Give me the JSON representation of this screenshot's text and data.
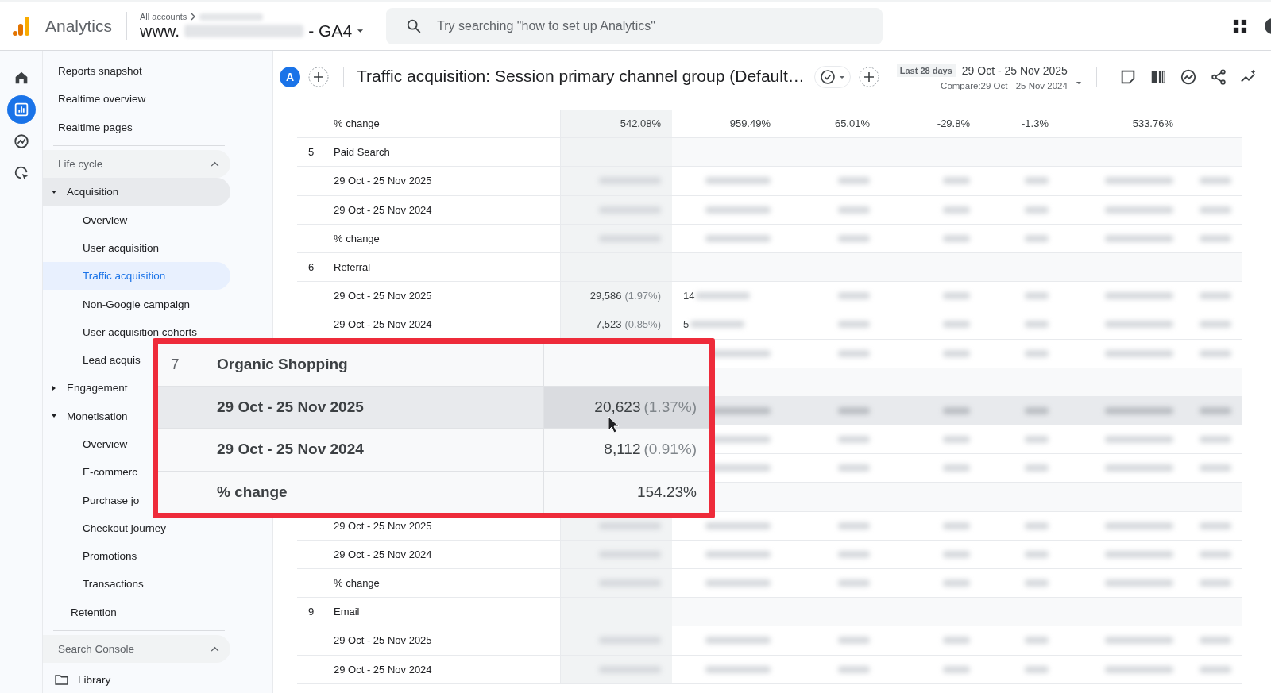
{
  "topbar": {
    "product": "Analytics",
    "breadcrumb": "All accounts",
    "property_prefix": "www.",
    "property_suffix": "- GA4",
    "search": {
      "placeholder": "Try searching \"how to set up Analytics\""
    }
  },
  "rail": [
    {
      "selected": false
    },
    {
      "selected": true
    },
    {
      "selected": false
    },
    {
      "selected": false
    }
  ],
  "nav": [
    {
      "kind": "link",
      "label": "Reports snapshot"
    },
    {
      "kind": "link",
      "label": "Realtime overview"
    },
    {
      "kind": "link",
      "label": "Realtime pages"
    },
    {
      "kind": "section",
      "label": "Life cycle",
      "expanded": true,
      "children": [
        {
          "kind": "topic",
          "label": "Acquisition",
          "expanded": true,
          "active": true,
          "children": [
            {
              "label": "Overview",
              "selected": false
            },
            {
              "label": "User acquisition",
              "selected": false
            },
            {
              "label": "Traffic acquisition",
              "selected": true
            },
            {
              "label": "Non-Google campaign",
              "selected": false
            },
            {
              "label": "User acquisition cohorts",
              "selected": false
            },
            {
              "label": "Lead acquis",
              "selected": false
            }
          ]
        },
        {
          "kind": "topic",
          "label": "Engagement",
          "expanded": false,
          "active": false
        },
        {
          "kind": "topic",
          "label": "Monetisation",
          "expanded": true,
          "active": false,
          "children": [
            {
              "label": "Overview",
              "selected": false
            },
            {
              "label": "E-commerc",
              "selected": false
            },
            {
              "label": "Purchase jo",
              "selected": false
            },
            {
              "label": "Checkout journey",
              "selected": false
            },
            {
              "label": "Promotions",
              "selected": false
            },
            {
              "label": "Transactions",
              "selected": false
            }
          ]
        },
        {
          "kind": "link",
          "label": "Retention"
        }
      ]
    },
    {
      "kind": "section",
      "label": "Search Console",
      "expanded": true
    },
    {
      "kind": "library",
      "label": "Library"
    }
  ],
  "report": {
    "avatar": "A",
    "title": "Traffic acquisition: Session primary channel group (Default…",
    "range_chip": "Last 28 days",
    "range": "29 Oct - 25 Nov 2025",
    "compare": "Compare:29 Oct - 25 Nov 2024"
  },
  "table": {
    "rows": [
      {
        "kind": "metric",
        "label": "% change",
        "values": [
          {
            "value": "542.08%"
          },
          {
            "value": "959.49%"
          },
          {
            "value": "65.01%"
          },
          {
            "value": "-29.8%"
          },
          {
            "value": "-1.3%"
          },
          {
            "value": "533.76%"
          }
        ]
      },
      {
        "kind": "group",
        "number": "5",
        "label": "Paid Search"
      },
      {
        "kind": "metric",
        "label": "29 Oct - 25 Nov 2025",
        "redacted": true
      },
      {
        "kind": "metric",
        "label": "29 Oct - 25 Nov 2024",
        "redacted": true
      },
      {
        "kind": "metric",
        "label": "% change",
        "redacted": true
      },
      {
        "kind": "group",
        "number": "6",
        "label": "Referral"
      },
      {
        "kind": "metric",
        "label": "29 Oct - 25 Nov 2025",
        "redacted": true,
        "values": [
          {
            "value": "29,586",
            "share": "(1.97%)"
          },
          {
            "value": "14",
            "kind": "partial"
          }
        ]
      },
      {
        "kind": "metric",
        "label": "29 Oct - 25 Nov 2024",
        "redacted": true,
        "values": [
          {
            "value": "7,523",
            "share": "(0.85%)"
          },
          {
            "value": "5",
            "kind": "partial"
          }
        ]
      },
      {
        "kind": "metric",
        "redacted": true
      },
      {
        "kind": "group"
      },
      {
        "kind": "metric",
        "redacted": true,
        "highlighted": true
      },
      {
        "kind": "metric",
        "redacted": true
      },
      {
        "kind": "metric",
        "redacted": true
      },
      {
        "kind": "group"
      },
      {
        "kind": "metric",
        "label": "29 Oct - 25 Nov 2025",
        "redacted": true
      },
      {
        "kind": "metric",
        "label": "29 Oct - 25 Nov 2024",
        "redacted": true
      },
      {
        "kind": "metric",
        "label": "% change",
        "redacted": true
      },
      {
        "kind": "group",
        "number": "9",
        "label": "Email"
      },
      {
        "kind": "metric",
        "label": "29 Oct - 25 Nov 2025",
        "redacted": true
      },
      {
        "kind": "metric",
        "label": "29 Oct - 25 Nov 2024",
        "redacted": true
      }
    ]
  },
  "callout": {
    "rows": [
      {
        "number": "7",
        "label": "Organic Shopping",
        "highlighted": false
      },
      {
        "label": "29 Oct - 25 Nov 2025",
        "value": "20,623",
        "share": "(1.37%)",
        "highlighted": true
      },
      {
        "label": "29 Oct - 25 Nov 2024",
        "value": "8,112",
        "share": "(0.91%)",
        "highlighted": false
      },
      {
        "label": "% change",
        "value": "154.23%",
        "highlighted": false
      }
    ]
  }
}
